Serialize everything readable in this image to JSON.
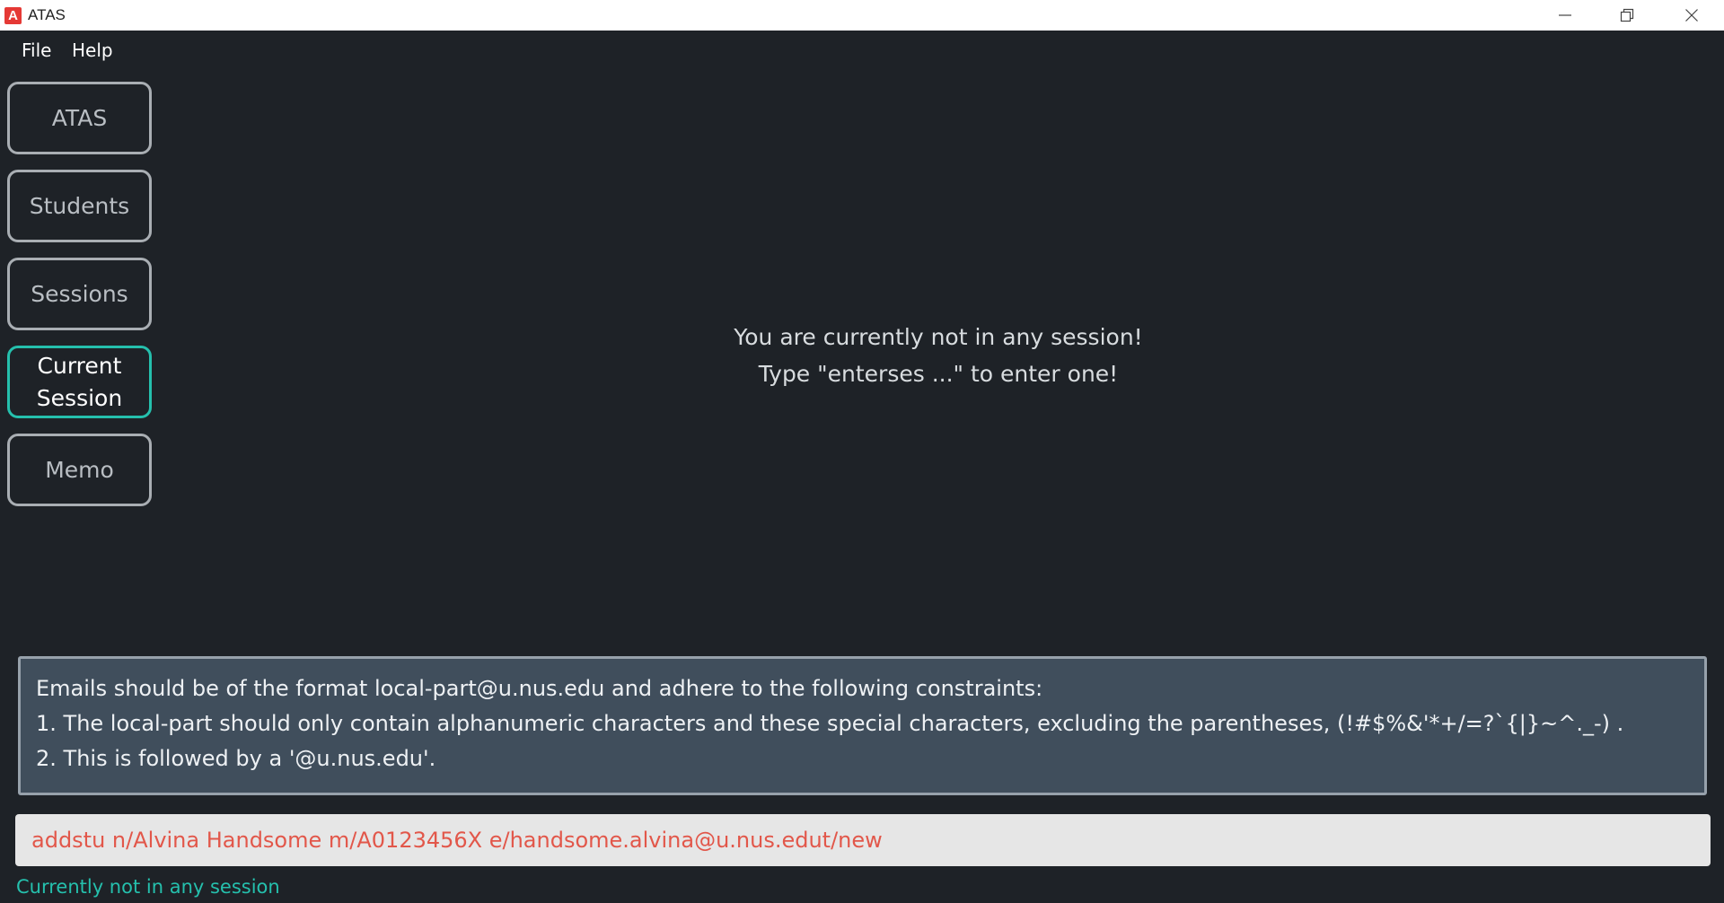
{
  "window": {
    "title": "ATAS",
    "app_icon_letter": "A"
  },
  "menu": {
    "items": [
      "File",
      "Help"
    ]
  },
  "nav": {
    "buttons": [
      {
        "label": "ATAS",
        "active": false
      },
      {
        "label": "Students",
        "active": false
      },
      {
        "label": "Sessions",
        "active": false
      },
      {
        "label": "Current\nSession",
        "active": true
      },
      {
        "label": "Memo",
        "active": false
      }
    ]
  },
  "main": {
    "message_line1": "You are currently not in any session!",
    "message_line2": "Type \"enterses ...\" to enter one!"
  },
  "result": {
    "lines": [
      "Emails should be of the format local-part@u.nus.edu and adhere to the following constraints:",
      "1. The local-part should only contain alphanumeric characters and these special characters, excluding the parentheses, (!#$%&'*+/=?`{|}~^._-) .",
      "2. This is followed by a '@u.nus.edu'."
    ]
  },
  "command": {
    "value": "addstu n/Alvina Handsome m/A0123456X e/handsome.alvina@u.nus.edut/new"
  },
  "status_bar": {
    "text": "Currently not in any session"
  },
  "colors": {
    "background": "#1e2227",
    "accent": "#25c0ad",
    "error_text": "#e2574a",
    "result_box": "#404e5c"
  },
  "icons": {
    "app": "app-logo-icon",
    "minimize": "minimize-icon",
    "restore": "restore-icon",
    "close": "close-icon"
  }
}
